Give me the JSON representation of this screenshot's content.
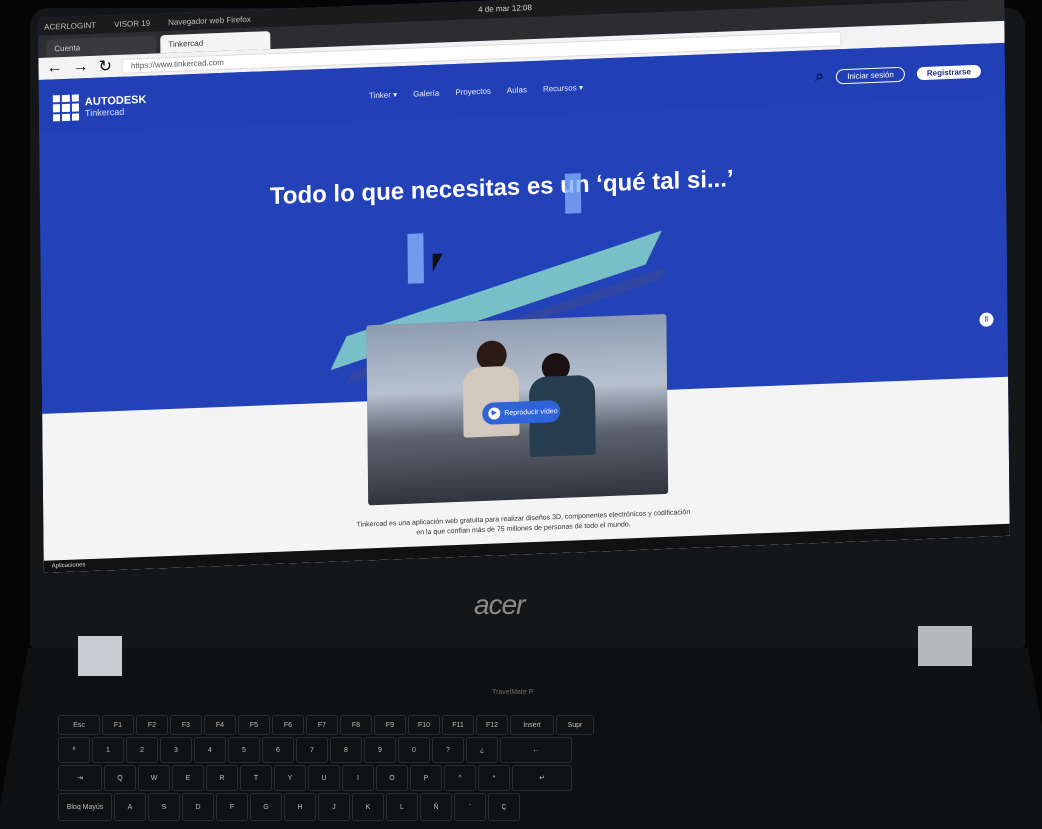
{
  "taskbar_left": "Aplicaciones",
  "browser": {
    "system_bar": {
      "items": [
        "ACERLOGINT",
        "VISOR 19",
        "Navegador web Firefox"
      ],
      "clock": "4 de mar 12:08"
    },
    "tabs": [
      "Cuenta",
      "Tinkercad"
    ],
    "url": "https://www.tinkercad.com"
  },
  "site": {
    "brand": "AUTODESK",
    "product": "Tinkercad",
    "menu": [
      "Tinker ▾",
      "Galería",
      "Proyectos",
      "Aulas",
      "Recursos ▾"
    ],
    "login": "Iniciar sesión",
    "register": "Registrarse",
    "hero_title": "Todo lo que necesitas es un ‘qué tal si...’",
    "video_button": "Reproducir vídeo",
    "description": "Tinkercad es una aplicación web gratuita para realizar diseños 3D, componentes electrónicos y codificación en la que confían más de 75 millones de personas de todo el mundo."
  },
  "laptop": {
    "brand": "acer",
    "model": "TravelMate P"
  },
  "keyboard_row_1": [
    "Esc",
    "F1",
    "F2",
    "F3",
    "F4",
    "F5",
    "F6",
    "F7",
    "F8",
    "F9",
    "F10",
    "F11",
    "F12",
    "Insert",
    "Supr"
  ],
  "keyboard_row_2": [
    "ª",
    "1",
    "2",
    "3",
    "4",
    "5",
    "6",
    "7",
    "8",
    "9",
    "0",
    "?",
    "¿",
    "←"
  ],
  "keyboard_row_3": [
    "⇥",
    "Q",
    "W",
    "E",
    "R",
    "T",
    "Y",
    "U",
    "I",
    "O",
    "P",
    "^",
    "*",
    "↵"
  ],
  "keyboard_row_4": [
    "Bloq Mayús",
    "A",
    "S",
    "D",
    "F",
    "G",
    "H",
    "J",
    "K",
    "L",
    "Ñ",
    "¨",
    "Ç"
  ]
}
